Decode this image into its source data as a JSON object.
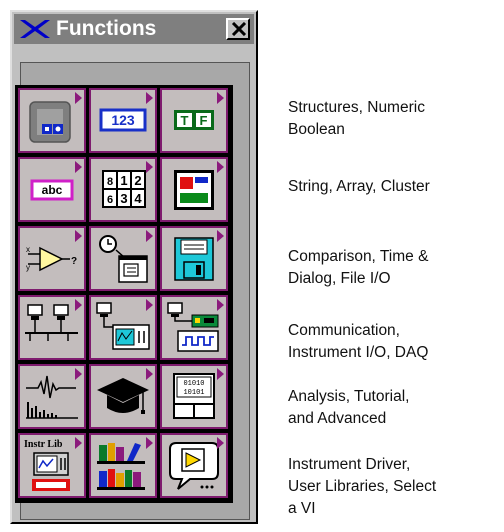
{
  "window": {
    "title": "Functions",
    "logo_icon": "labview-logo-icon",
    "close_icon": "close-icon"
  },
  "palette": {
    "rows": [
      {
        "icons": [
          "structures-icon",
          "numeric-icon",
          "boolean-icon"
        ],
        "label_lines": [
          "Structures, Numeric",
          "Boolean"
        ]
      },
      {
        "icons": [
          "string-icon",
          "array-icon",
          "cluster-icon"
        ],
        "label_lines": [
          "String, Array, Cluster"
        ]
      },
      {
        "icons": [
          "comparison-icon",
          "time-dialog-icon",
          "file-io-icon"
        ],
        "label_lines": [
          "Comparison, Time &",
          "Dialog, File I/O"
        ]
      },
      {
        "icons": [
          "communication-icon",
          "instrument-io-icon",
          "daq-icon"
        ],
        "label_lines": [
          "Communication,",
          "Instrument I/O, DAQ"
        ]
      },
      {
        "icons": [
          "analysis-icon",
          "tutorial-icon",
          "advanced-icon"
        ],
        "label_lines": [
          "Analysis, Tutorial,",
          "and Advanced"
        ]
      },
      {
        "icons": [
          "instrument-driver-icon",
          "user-libraries-icon",
          "select-vi-icon"
        ],
        "label_lines": [
          "Instrument Driver,",
          "User Libraries, Select",
          "a VI"
        ]
      }
    ],
    "numeric_text": "123",
    "boolean_t": "T",
    "boolean_f": "F",
    "string_text": "abc",
    "array_digits": [
      "8",
      "1",
      "2",
      "6",
      "3",
      "4"
    ],
    "instr_lib_text": "Instr Lib"
  }
}
